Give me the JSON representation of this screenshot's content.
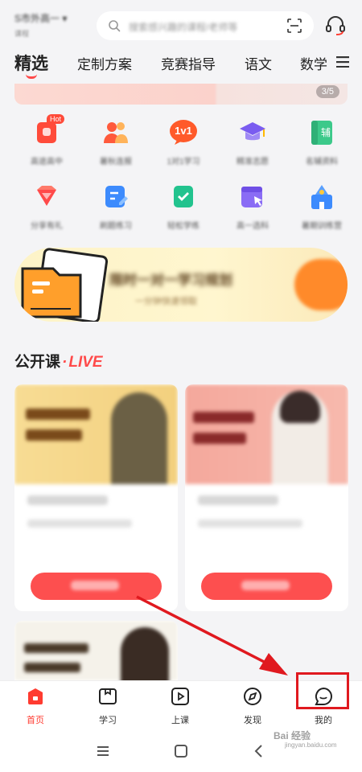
{
  "header": {
    "location": "S市外高一 ▾",
    "location_sub": "课程",
    "search_placeholder": "搜索感兴趣的课程/老师等"
  },
  "tabs": [
    {
      "label": "精选",
      "active": true
    },
    {
      "label": "定制方案"
    },
    {
      "label": "竞赛指导"
    },
    {
      "label": "语文"
    },
    {
      "label": "数学"
    }
  ],
  "banner": {
    "counter": "3/5"
  },
  "grid": [
    {
      "icon": "hot-course-icon",
      "label": "高途高中",
      "badge": "Hot",
      "color": "#ff4b3a"
    },
    {
      "icon": "group-class-icon",
      "label": "暑秋连报",
      "color": "#ff5a3c"
    },
    {
      "icon": "one-on-one-icon",
      "label": "1对1学习",
      "badge_text": "1v1",
      "color": "#ff5a2a"
    },
    {
      "icon": "graduation-cap-icon",
      "label": "精准志愿",
      "color": "#7a5cf0"
    },
    {
      "icon": "tutoring-book-icon",
      "label": "名辅资料",
      "badge_text": "辅",
      "color": "#3cc98a"
    },
    {
      "icon": "gift-icon",
      "label": "分享有礼",
      "color": "#ff4a4a"
    },
    {
      "icon": "practice-icon",
      "label": "刷题练习",
      "color": "#3d8bfd"
    },
    {
      "icon": "checklist-icon",
      "label": "轻松学练",
      "color": "#22c38e"
    },
    {
      "icon": "calendar-select-icon",
      "label": "高一选科",
      "color": "#8a6cf5"
    },
    {
      "icon": "school-icon",
      "label": "暑期训练营",
      "color": "#3d8bfd"
    }
  ],
  "promo": {
    "title": "限时一对一学习规划",
    "subtitle": "一分钟快速领取"
  },
  "section": {
    "title": "公开课",
    "dot": "·",
    "live": "LIVE"
  },
  "cards": [
    {
      "line1": "高中化学提分",
      "line2": "今晚19:00",
      "button": "立即预约",
      "img_color": "#f6d68c"
    },
    {
      "line1": "高中数学冲刺",
      "line2": "今晚20:00",
      "button": "立即预约",
      "img_color": "#f6a79c"
    }
  ],
  "bottom_nav": [
    {
      "label": "首页",
      "icon": "home-icon",
      "active": true
    },
    {
      "label": "学习",
      "icon": "study-icon"
    },
    {
      "label": "上课",
      "icon": "play-class-icon"
    },
    {
      "label": "发现",
      "icon": "compass-icon"
    },
    {
      "label": "我的",
      "icon": "profile-face-icon"
    }
  ],
  "watermark": {
    "main": "Bai 经验",
    "sub": "jingyan.baidu.com"
  },
  "colors": {
    "accent": "#ff3b30",
    "annotation": "#e0191f"
  }
}
